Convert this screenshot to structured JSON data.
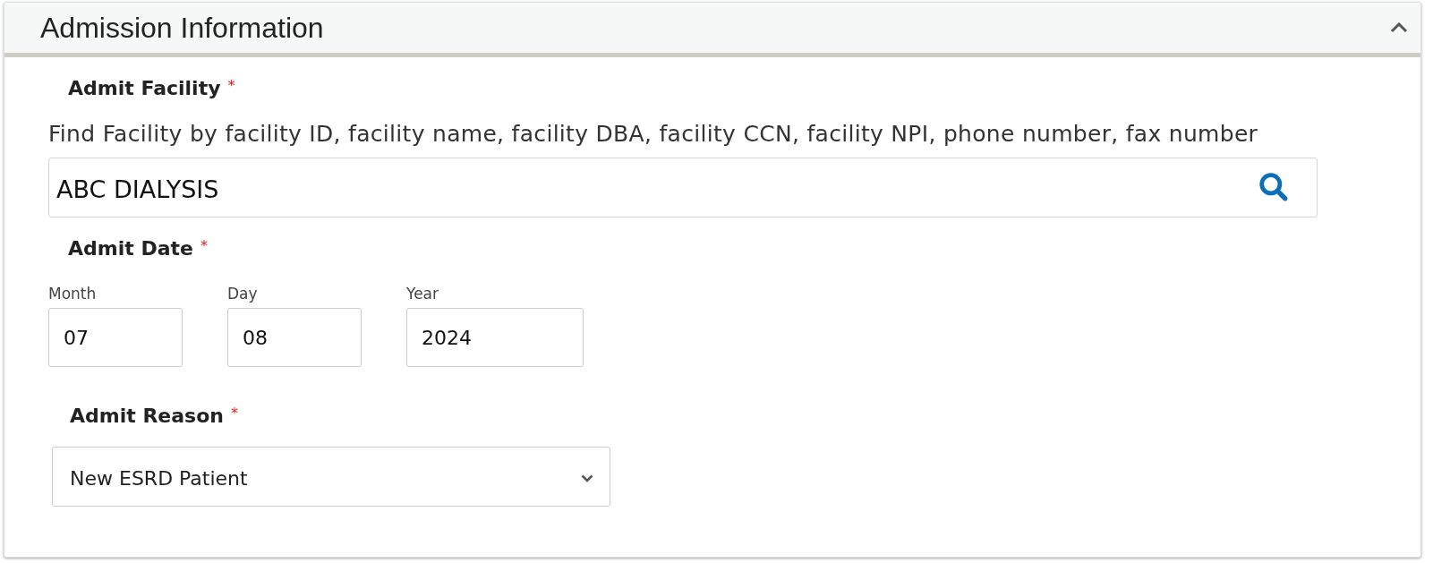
{
  "panel": {
    "title": "Admission Information",
    "expanded": true
  },
  "facility": {
    "label": "Admit Facility",
    "required_mark": "*",
    "hint": "Find Facility by facility ID, facility name, facility DBA, facility CCN, facility NPI, phone number, fax number",
    "value": "ABC DIALYSIS"
  },
  "date": {
    "label": "Admit Date",
    "required_mark": "*",
    "parts": [
      {
        "label": "Month",
        "value": "07"
      },
      {
        "label": "Day",
        "value": "08"
      },
      {
        "label": "Year",
        "value": "2024"
      }
    ]
  },
  "reason": {
    "label": "Admit Reason",
    "required_mark": "*",
    "value": "New ESRD Patient"
  }
}
